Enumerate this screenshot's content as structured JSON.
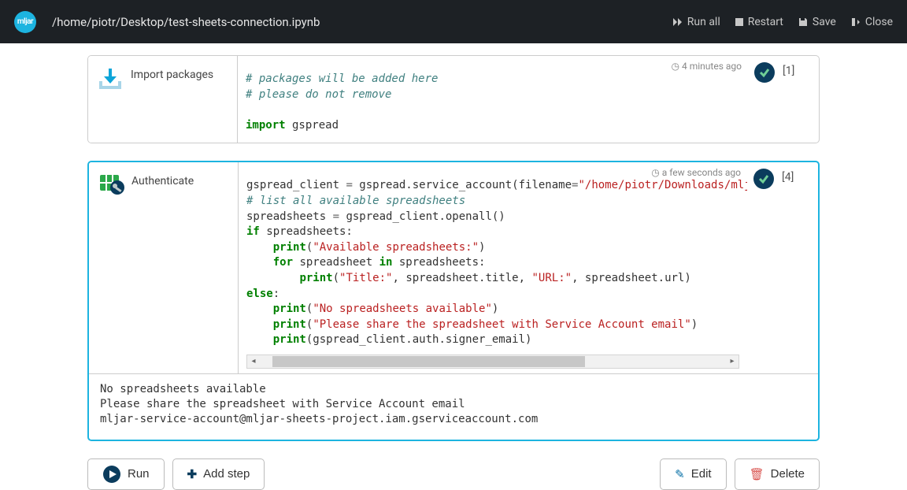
{
  "header": {
    "logo_text": "mljar",
    "path": "/home/piotr/Desktop/test-sheets-connection.ipynb",
    "actions": {
      "run_all": "Run all",
      "restart": "Restart",
      "save": "Save",
      "close": "Close"
    }
  },
  "cells": [
    {
      "label": "Import packages",
      "timestamp": "4 minutes ago",
      "exec_count": "[1]",
      "code_html": "<span class=\"c-cmt\"># packages will be added here</span>\n<span class=\"c-cmt\"># please do not remove</span>\n\n<span class=\"c-kw\">import</span> gspread"
    },
    {
      "label": "Authenticate",
      "timestamp": "a few seconds ago",
      "exec_count": "[4]",
      "code_html": "gspread_client <span class=\"c-op\">=</span> gspread.service_account(filename<span class=\"c-op\">=</span><span class=\"c-str\">\"/home/piotr/Downloads/mljar-s</span>\n<span class=\"c-cmt\"># list all available spreadsheets</span>\nspreadsheets <span class=\"c-op\">=</span> gspread_client.openall()\n<span class=\"c-kw\">if</span> spreadsheets:\n    <span class=\"c-kw\">print</span>(<span class=\"c-str\">\"Available spreadsheets:\"</span>)\n    <span class=\"c-kw\">for</span> spreadsheet <span class=\"c-kw\">in</span> spreadsheets:\n        <span class=\"c-kw\">print</span>(<span class=\"c-str\">\"Title:\"</span>, spreadsheet.title, <span class=\"c-str\">\"URL:\"</span>, spreadsheet.url)\n<span class=\"c-kw\">else</span>:\n    <span class=\"c-kw\">print</span>(<span class=\"c-str\">\"No spreadsheets available\"</span>)\n    <span class=\"c-kw\">print</span>(<span class=\"c-str\">\"Please share the spreadsheet with Service Account email\"</span>)\n    <span class=\"c-kw\">print</span>(gspread_client.auth.signer_email)",
      "output": "No spreadsheets available\nPlease share the spreadsheet with Service Account email\nmljar-service-account@mljar-sheets-project.iam.gserviceaccount.com"
    }
  ],
  "footer": {
    "run": "Run",
    "add_step": "Add step",
    "edit": "Edit",
    "delete": "Delete"
  }
}
